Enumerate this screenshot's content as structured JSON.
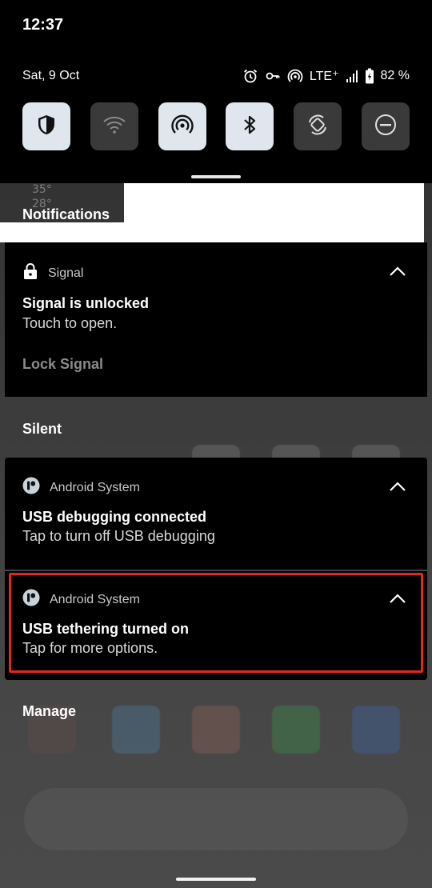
{
  "status_bar": {
    "time": "12:37",
    "date": "Sat, 9 Oct",
    "network": "LTE⁺",
    "battery": "82 %"
  },
  "quick_tiles": [
    {
      "icon": "shield-icon",
      "state": "on"
    },
    {
      "icon": "wifi-icon",
      "state": "off"
    },
    {
      "icon": "hotspot-icon",
      "state": "on"
    },
    {
      "icon": "bluetooth-icon",
      "state": "on"
    },
    {
      "icon": "auto-rotate-icon",
      "state": "off"
    },
    {
      "icon": "do-not-disturb-icon",
      "state": "off"
    }
  ],
  "background": {
    "weather_line1": "35°",
    "weather_line2": "28°"
  },
  "notifications_header": "Notifications",
  "signal_card": {
    "app": "Signal",
    "title": "Signal is unlocked",
    "body": "Touch to open.",
    "action": "Lock Signal"
  },
  "silent_label": "Silent",
  "usb_debug_card": {
    "app": "Android System",
    "title": "USB debugging connected",
    "body": "Tap to turn off USB debugging"
  },
  "usb_tether_card": {
    "app": "Android System",
    "title": "USB tethering turned on",
    "body": "Tap for more options."
  },
  "manage_label": "Manage",
  "colors": {
    "highlight": "#e0281f",
    "tile_on": "#dfe6ee",
    "tile_off": "#3a3a3a"
  }
}
